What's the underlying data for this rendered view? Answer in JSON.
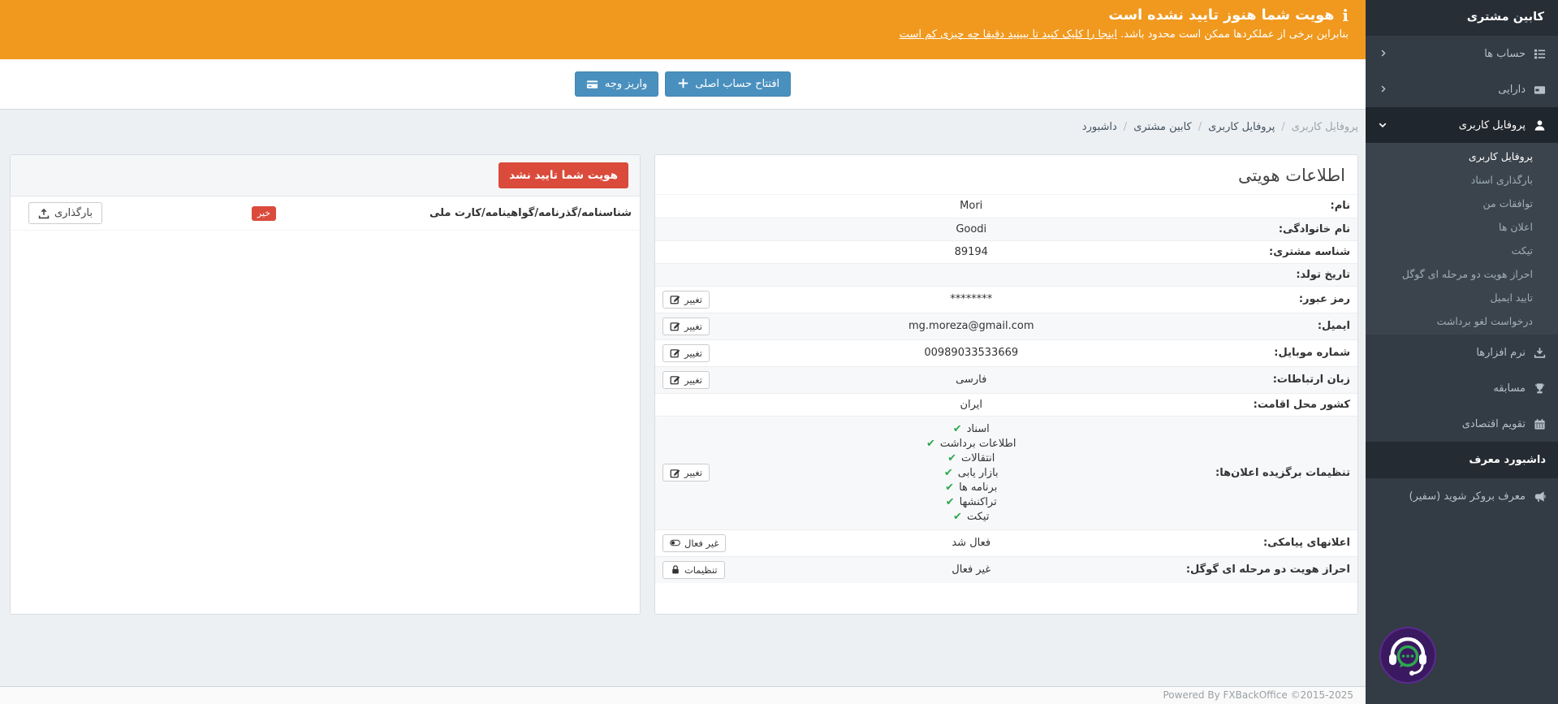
{
  "sidebar": {
    "title": "کابین مشتری",
    "items": [
      {
        "label": "حساب ها",
        "icon": "list-icon"
      },
      {
        "label": "دارایی",
        "icon": "wallet-icon"
      },
      {
        "label": "پروفایل کاربری",
        "icon": "user-icon"
      },
      {
        "label": "نرم افزارها",
        "icon": "download-icon"
      },
      {
        "label": "مسابقه",
        "icon": "trophy-icon"
      },
      {
        "label": "تقویم اقتصادی",
        "icon": "calendar-icon"
      },
      {
        "label": "داشبورد معرف"
      },
      {
        "label": "معرف بروکر شوید (سفیر)",
        "icon": "bullhorn-icon"
      }
    ],
    "submenu": [
      "پروفایل کاربری",
      "بارگذاری اسناد",
      "توافقات من",
      "اعلان ها",
      "تیکت",
      "احراز هویت دو مرحله ای گوگل",
      "تایید ایمیل",
      "درخواست لغو برداشت"
    ]
  },
  "banner": {
    "title": "هویت شما هنوز تایید نشده است",
    "subtitle_prefix": "بنابراین برخی از عملکردها ممکن است محدود باشد. ",
    "subtitle_link": "اینجا را کلیک کنید تا ببینید دقیقا چه چیزی کم است"
  },
  "toolbar": {
    "open_account_label": "افتتاح حساب اصلی",
    "deposit_label": "واریز وجه"
  },
  "breadcrumb": {
    "items": [
      "داشبورد",
      "کابین مشتری",
      "پروفایل کاربری"
    ],
    "current": "پروفایل کاربری",
    "separator": "/"
  },
  "identity": {
    "title": "اطلاعات هویتی",
    "rows": [
      {
        "label": "نام:",
        "value": "Mori"
      },
      {
        "label": "نام خانوادگی:",
        "value": "Goodi"
      },
      {
        "label": "شناسه مشتری:",
        "value": "89194"
      },
      {
        "label": "تاریخ تولد:",
        "value": ""
      },
      {
        "label": "رمز عبور:",
        "value": "********"
      },
      {
        "label": "ایمیل:",
        "value": "mg.moreza@gmail.com"
      },
      {
        "label": "شماره موبایل:",
        "value": "00989033533669"
      },
      {
        "label": "زبان ارتباطات:",
        "value": "فارسی"
      },
      {
        "label": "کشور محل اقامت:",
        "value": "ایران"
      },
      {
        "label": "تنظیمات برگزیده اعلان‌ها:",
        "value": ""
      },
      {
        "label": "اعلانهای پیامکی:",
        "value": "فعال شد"
      },
      {
        "label": "احراز هویت دو مرحله ای گوگل:",
        "value": "غیر فعال"
      }
    ],
    "options": [
      "اسناد",
      "اطلاعات برداشت",
      "انتقالات",
      "بازار یابی",
      "برنامه ها",
      "تراکنشها",
      "تیکت"
    ],
    "buttons": {
      "change": "تغییر",
      "disable": "غیر فعال",
      "settings": "تنظیمات"
    }
  },
  "verification": {
    "status_badge": "هویت شما تایید نشد",
    "doc_name": "شناسنامه/گذرنامه/گواهینامه/کارت ملی",
    "doc_status": "خیر",
    "upload_label": "بارگذاری"
  },
  "footer": {
    "text": "Powered By FXBackOffice ©2015-2025"
  },
  "colors": {
    "banner_orange": "#f0991e",
    "sidebar_dark": "#333b44",
    "primary_blue": "#4a90bf",
    "danger_red": "#da4b3b",
    "success_green": "#2ba94f"
  }
}
